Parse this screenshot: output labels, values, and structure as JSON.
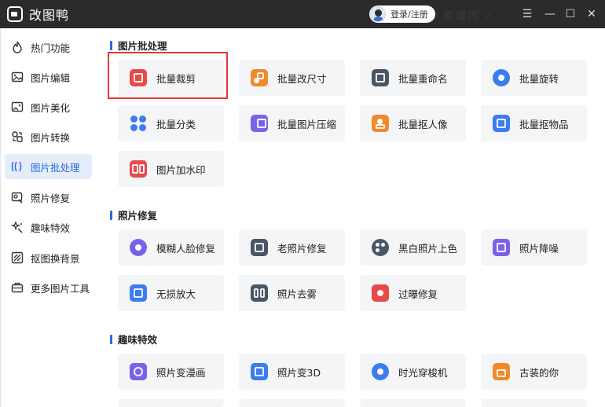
{
  "app": {
    "title": "改图鸭",
    "login_label": "登录/注册",
    "brand_script": "看懂鸭 ⟡"
  },
  "window_controls": {
    "menu": "☰",
    "minimize": "—",
    "maximize": "☐",
    "close": "✕"
  },
  "sidebar": {
    "items": [
      {
        "label": "热门功能",
        "icon": "flame-icon",
        "active": false
      },
      {
        "label": "图片编辑",
        "icon": "image-edit-icon",
        "active": false
      },
      {
        "label": "图片美化",
        "icon": "image-beautify-icon",
        "active": false
      },
      {
        "label": "图片转换",
        "icon": "convert-icon",
        "active": false
      },
      {
        "label": "图片批处理",
        "icon": "batch-icon",
        "active": true
      },
      {
        "label": "照片修复",
        "icon": "photo-repair-icon",
        "active": false
      },
      {
        "label": "趣味特效",
        "icon": "sparkle-icon",
        "active": false
      },
      {
        "label": "抠图换背景",
        "icon": "cutout-icon",
        "active": false
      },
      {
        "label": "更多图片工具",
        "icon": "toolbox-icon",
        "active": false
      }
    ]
  },
  "sections": {
    "batch": {
      "title": "图片批处理",
      "cards": [
        {
          "label": "批量裁剪",
          "icon": "crop-icon",
          "color": "#e84a4a"
        },
        {
          "label": "批量改尺寸",
          "icon": "resize-icon",
          "color": "#f08a2a"
        },
        {
          "label": "批量重命名",
          "icon": "rename-icon",
          "color": "#4a5566"
        },
        {
          "label": "批量旋转",
          "icon": "rotate-icon",
          "color": "#3d7bf0"
        },
        {
          "label": "批量分类",
          "icon": "classify-icon",
          "color": "#3d7bf0"
        },
        {
          "label": "批量图片压缩",
          "icon": "compress-icon",
          "color": "#7b61e8"
        },
        {
          "label": "批量抠人像",
          "icon": "portrait-cutout-icon",
          "color": "#f08a2a"
        },
        {
          "label": "批量抠物品",
          "icon": "object-cutout-icon",
          "color": "#3d7bf0"
        },
        {
          "label": "图片加水印",
          "icon": "watermark-icon",
          "color": "#e84a4a"
        }
      ]
    },
    "repair": {
      "title": "照片修复",
      "cards": [
        {
          "label": "模糊人脸修复",
          "icon": "face-repair-icon",
          "color": "#7b61e8"
        },
        {
          "label": "老照片修复",
          "icon": "old-photo-icon",
          "color": "#4a5566"
        },
        {
          "label": "黑白照片上色",
          "icon": "palette-icon",
          "color": "#4a5566"
        },
        {
          "label": "照片降噪",
          "icon": "denoise-icon",
          "color": "#7b61e8"
        },
        {
          "label": "无损放大",
          "icon": "upscale-icon",
          "color": "#3d7bf0"
        },
        {
          "label": "照片去雾",
          "icon": "dehaze-icon",
          "color": "#4a5566"
        },
        {
          "label": "过曝修复",
          "icon": "exposure-icon",
          "color": "#e84a4a"
        }
      ]
    },
    "fun": {
      "title": "趣味特效",
      "cards": [
        {
          "label": "照片变漫画",
          "icon": "comic-icon",
          "color": "#7b61e8"
        },
        {
          "label": "照片变3D",
          "icon": "cube-3d-icon",
          "color": "#3d7bf0"
        },
        {
          "label": "时光穿梭机",
          "icon": "time-machine-icon",
          "color": "#3d7bf0"
        },
        {
          "label": "古装的你",
          "icon": "ancient-house-icon",
          "color": "#f08a2a"
        }
      ]
    }
  }
}
